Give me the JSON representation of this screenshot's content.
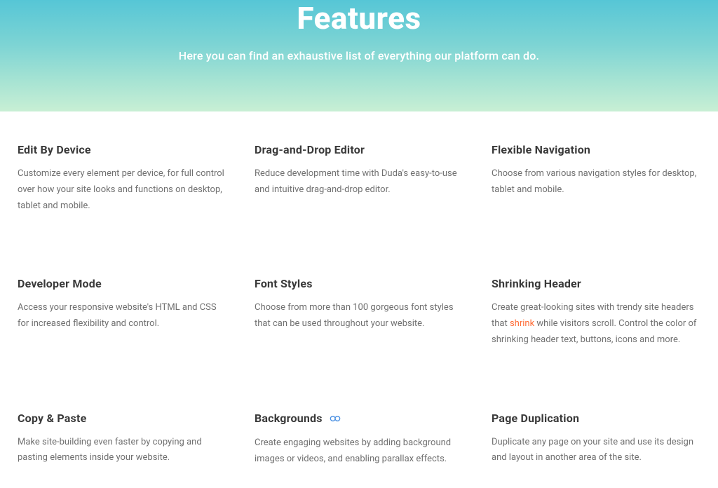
{
  "hero": {
    "title": "Features",
    "subtitle": "Here you can find an exhaustive list of everything our platform can do."
  },
  "features": [
    {
      "title": "Edit By Device",
      "desc": "Customize every element per device, for full control over how your site looks and functions on desktop, tablet and mobile.",
      "has_link_icon": false
    },
    {
      "title": "Drag-and-Drop Editor",
      "desc": "Reduce development time with Duda's easy-to-use and intuitive drag-and-drop editor.",
      "has_link_icon": false
    },
    {
      "title": "Flexible Navigation",
      "desc": "Choose from various navigation styles for desktop, tablet and mobile.",
      "has_link_icon": false
    },
    {
      "title": "Developer Mode",
      "desc": "Access your responsive website's HTML and CSS for increased flexibility and control.",
      "has_link_icon": false
    },
    {
      "title": "Font Styles",
      "desc": "Choose from more than 100 gorgeous font styles that can be used throughout your website.",
      "has_link_icon": false
    },
    {
      "title": "Shrinking Header",
      "desc_pre": "Create great-looking sites with trendy site headers that ",
      "link_text": "shrink",
      "desc_post": " while visitors scroll. Control the color of shrinking header text, buttons, icons and more.",
      "has_inline_link": true,
      "has_link_icon": false
    },
    {
      "title": "Copy & Paste",
      "desc": "Make site-building even faster by copying and pasting elements inside your website.",
      "has_link_icon": false
    },
    {
      "title": "Backgrounds",
      "desc": "Create engaging websites by adding background images or videos, and enabling parallax effects.",
      "has_link_icon": true
    },
    {
      "title": "Page Duplication",
      "desc": "Duplicate any page on your site and use its design and layout in another area of the site.",
      "has_link_icon": false
    }
  ]
}
